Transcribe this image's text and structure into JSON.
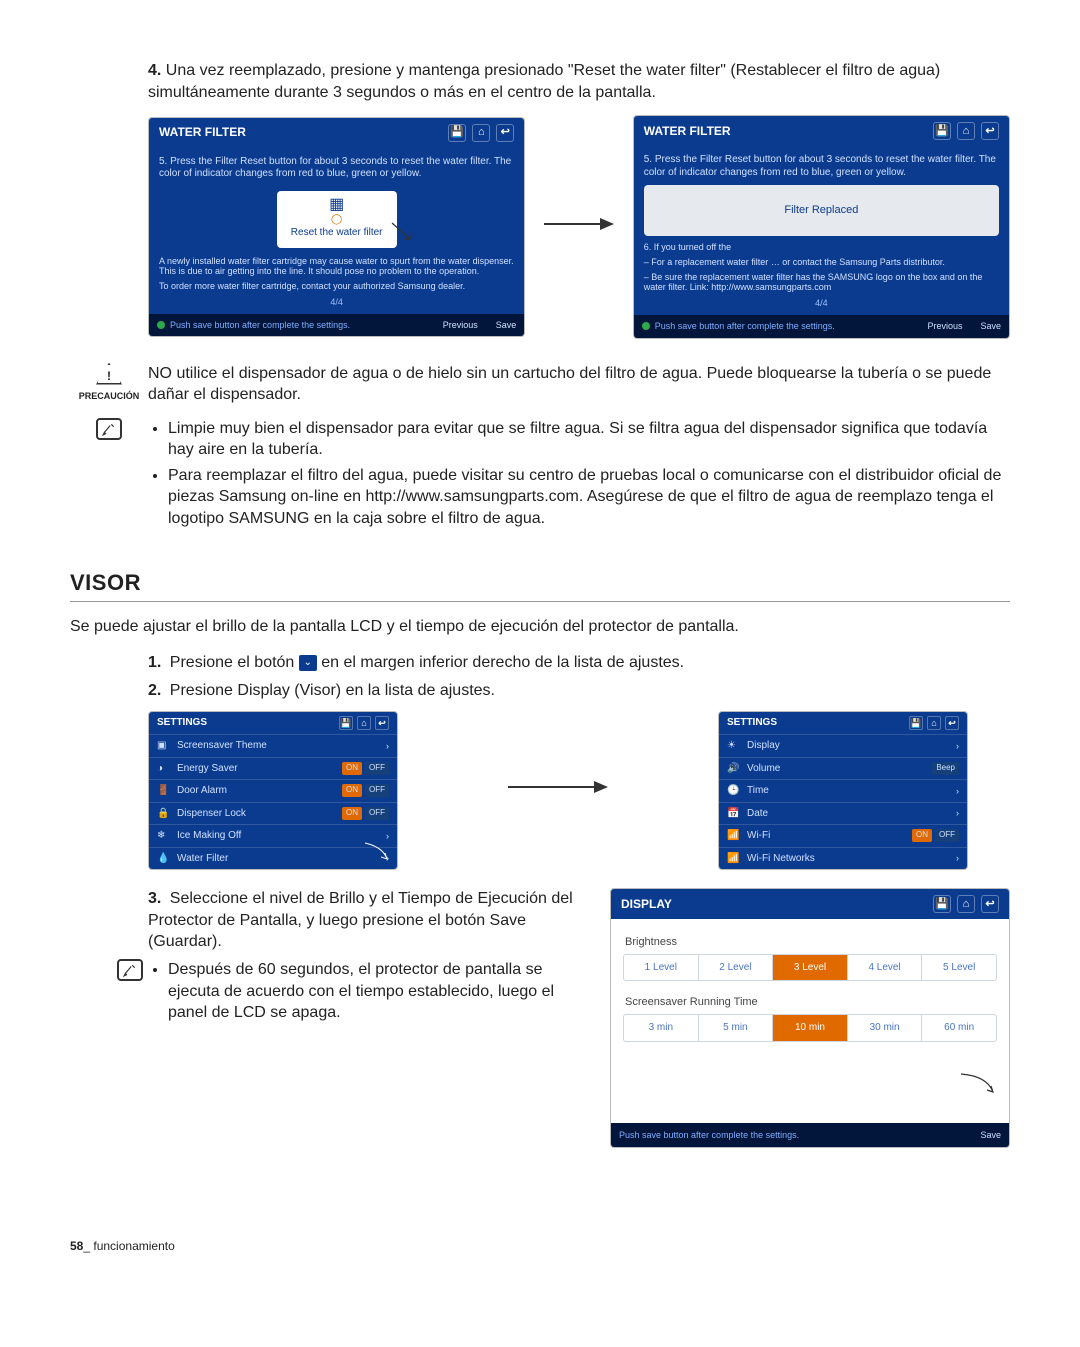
{
  "step4": {
    "number": "4.",
    "text": "Una vez reemplazado, presione y mantenga presionado \"Reset the water filter\" (Restablecer el filtro de agua) simultáneamente durante 3 segundos o más en el centro de la pantalla."
  },
  "waterFilterScreen": {
    "title": "WATER FILTER",
    "line5": "5. Press the Filter Reset button for about 3 seconds to reset the water filter. The color of indicator changes from red to blue, green or yellow.",
    "resetLabel": "Reset the water filter",
    "noteA": "A newly installed water filter cartridge may cause water to spurt from the water dispenser. This is due to air getting into the line. It should pose no problem to the operation.",
    "noteB": "To order more water filter cartridge, contact your authorized Samsung dealer.",
    "page": "4/4",
    "footHint": "Push save button after complete the settings.",
    "prev": "Previous",
    "save": "Save"
  },
  "filterReplaced": {
    "popup": "Filter Replaced",
    "line6": "6. If you turned off the",
    "subA": "– For a replacement water filter … or contact the Samsung Parts distributor.",
    "subB": "– Be sure the replacement water filter has the SAMSUNG logo on the box and on the water filter. Link: http://www.samsungparts.com"
  },
  "caution": {
    "label": "PRECAUCIÓN",
    "text": "NO utilice el dispensador de agua o de hielo sin un cartucho del filtro de agua. Puede bloquearse la tubería o se puede dañar el dispensador."
  },
  "tips": {
    "b1": "Limpie muy bien el dispensador para evitar que se filtre agua. Si se filtra agua del dispensador significa que todavía hay aire en la tubería.",
    "b2": "Para reemplazar el filtro del agua, puede visitar su centro de pruebas local o comunicarse con el distribuidor oficial de piezas Samsung on-line en http://www.samsungparts.com. Asegúrese de que el filtro de agua de reemplazo tenga el logotipo SAMSUNG en la caja sobre el filtro de agua."
  },
  "visor": {
    "heading": "VISOR",
    "intro": "Se puede ajustar el brillo de la pantalla LCD y el tiempo de ejecución del protector de pantalla.",
    "step1": {
      "num": "1.",
      "before": "Presione el botón ",
      "after": " en el margen inferior derecho de la lista de ajustes."
    },
    "step2": {
      "num": "2.",
      "text": "Presione Display (Visor) en la lista de ajustes."
    }
  },
  "settingsLeft": {
    "title": "SETTINGS",
    "rows": [
      {
        "icon": "▣",
        "label": "Screensaver Theme",
        "right": ""
      },
      {
        "icon": "◑",
        "label": "Energy Saver",
        "right": "OFF",
        "on": "ON"
      },
      {
        "icon": "🚪",
        "label": "Door Alarm",
        "right": "OFF",
        "on": "ON"
      },
      {
        "icon": "🔒",
        "label": "Dispenser Lock",
        "right": "OFF",
        "on": "ON"
      },
      {
        "icon": "❄",
        "label": "Ice Making Off",
        "right": ""
      },
      {
        "icon": "💧",
        "label": "Water Filter",
        "right": ""
      }
    ]
  },
  "settingsRight": {
    "title": "SETTINGS",
    "rows": [
      {
        "icon": "☀",
        "label": "Display",
        "right": ""
      },
      {
        "icon": "🔊",
        "label": "Volume",
        "right": "Beep"
      },
      {
        "icon": "🕒",
        "label": "Time",
        "right": ""
      },
      {
        "icon": "📅",
        "label": "Date",
        "right": ""
      },
      {
        "icon": "📶",
        "label": "Wi-Fi",
        "right": "OFF",
        "on": "ON"
      },
      {
        "icon": "📶",
        "label": "Wi-Fi Networks",
        "right": ""
      }
    ]
  },
  "step3": {
    "num": "3.",
    "text": "Seleccione el nivel de Brillo y el Tiempo de Ejecución del Protector de Pantalla, y luego presione el botón Save (Guardar).",
    "tip": "Después de 60 segundos, el protector de pantalla se ejecuta de acuerdo con el tiempo establecido, luego el panel de LCD se apaga."
  },
  "displayPanel": {
    "title": "DISPLAY",
    "brightnessLabel": "Brightness",
    "brightness": [
      "1 Level",
      "2 Level",
      "3 Level",
      "4 Level",
      "5 Level"
    ],
    "brightnessSelected": 2,
    "runtimeLabel": "Screensaver Running Time",
    "runtime": [
      "3 min",
      "5 min",
      "10 min",
      "30 min",
      "60 min"
    ],
    "runtimeSelected": 2,
    "footHint": "Push save button after complete the settings.",
    "save": "Save"
  },
  "footer": {
    "page": "58",
    "section": "_ funcionamiento"
  }
}
